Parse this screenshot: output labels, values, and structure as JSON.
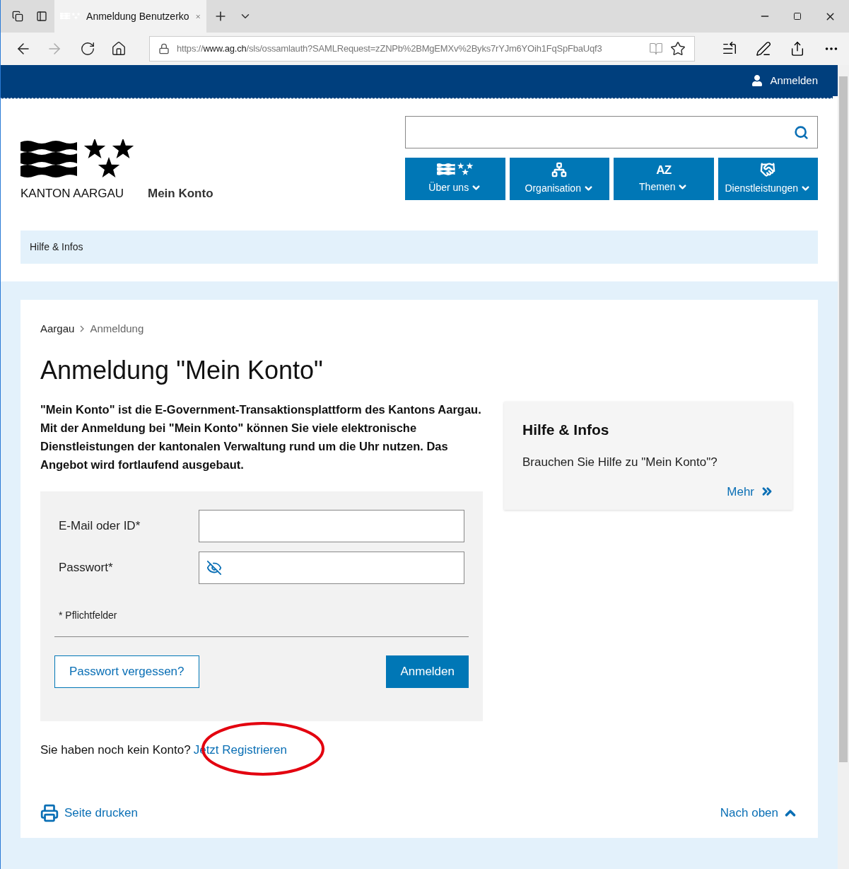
{
  "browser": {
    "tab_title": "Anmeldung Benutzerko",
    "url": {
      "scheme": "https://",
      "host": "www.ag.ch",
      "path": "/sls/ossamlauth?SAMLRequest=zZNPb%2BMgEMXv%2Byks7rYJm6YOih1FqSpFbaUqf3"
    }
  },
  "topbar": {
    "login": "Anmelden"
  },
  "logo": {
    "name": "KANTON AARGAU",
    "product": "Mein Konto"
  },
  "nav": [
    {
      "label": "Über uns",
      "kind": "emblem"
    },
    {
      "label": "Organisation",
      "kind": "org"
    },
    {
      "label": "Themen",
      "kind": "letters",
      "icon_text": "AZ"
    },
    {
      "label": "Dienstleistungen",
      "kind": "handshake"
    }
  ],
  "subnav": {
    "label": "Hilfe & Infos"
  },
  "breadcrumb": [
    {
      "label": "Aargau",
      "current": false
    },
    {
      "label": "Anmeldung",
      "current": true
    }
  ],
  "title": "Anmeldung \"Mein Konto\"",
  "intro": "\"Mein Konto\" ist die E-Government-Transaktionsplattform des Kantons Aargau. Mit der Anmeldung bei \"Mein Konto\" können Sie viele elektronische Dienstleistungen der kantonalen Verwaltung rund um die Uhr nutzen. Das Angebot wird fortlaufend ausgebaut.",
  "form": {
    "fields": [
      {
        "label": "E-Mail oder ID*",
        "kind": "text"
      },
      {
        "label": "Passwort*",
        "kind": "password"
      }
    ],
    "required_note": "* Pflichtfelder",
    "forgot": "Passwort vergessen?",
    "submit": "Anmelden"
  },
  "register": {
    "text": "Sie haben noch kein Konto?",
    "link": "Jetzt Registrieren"
  },
  "help_box": {
    "title": "Hilfe & Infos",
    "text": "Brauchen Sie Hilfe zu \"Mein Konto\"?",
    "link": "Mehr"
  },
  "footer": {
    "print": "Seite drucken",
    "top": "Nach oben"
  },
  "annotation": {
    "kind": "ellipse"
  }
}
